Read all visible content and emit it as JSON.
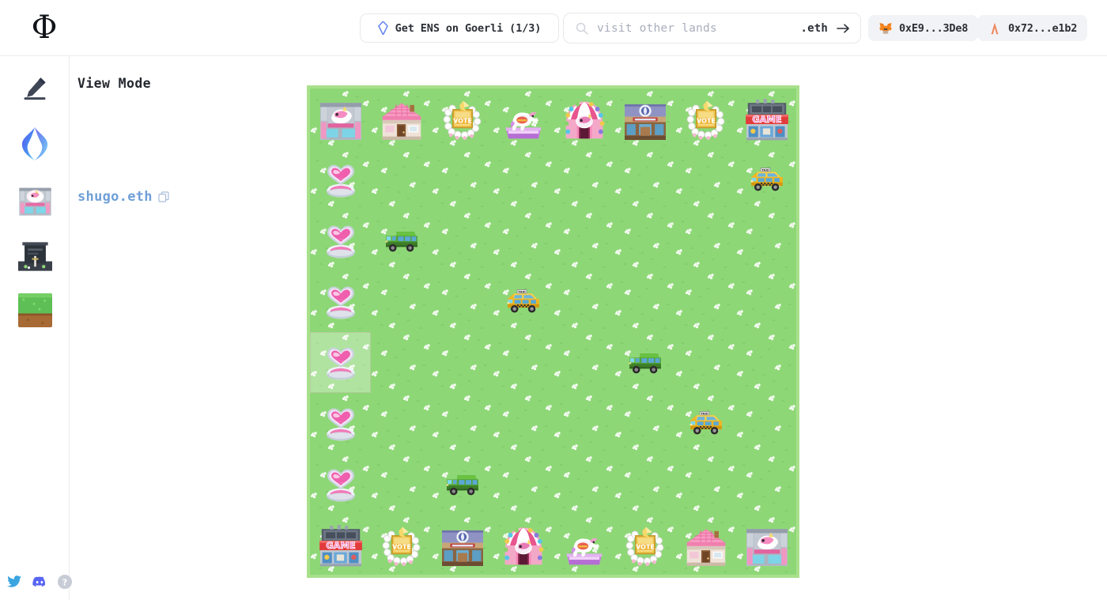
{
  "header": {
    "logo_glyph": "Φ",
    "ens_button": {
      "label": "Get ENS on Goerli (1/3)",
      "icon": "ens-diamond-icon"
    },
    "search": {
      "placeholder": "visit other lands",
      "value": "",
      "suffix": ".eth",
      "icon": "search-icon",
      "submit_icon": "arrow-right-icon"
    },
    "wallets": [
      {
        "label": "0xE9...3De8",
        "icon": "metamask-fox-icon"
      },
      {
        "label": "0x72...e1b2",
        "icon": "wallet-connect-icon"
      }
    ]
  },
  "sidebar": {
    "tools": [
      {
        "name": "edit-pen",
        "icon": "pen-icon"
      },
      {
        "name": "ens",
        "icon": "ens-logo-icon"
      },
      {
        "name": "shop",
        "icon": "unicorn-shop-sprite"
      },
      {
        "name": "building",
        "icon": "dark-building-sprite"
      },
      {
        "name": "ground",
        "icon": "grass-tile-sprite"
      }
    ],
    "socials": [
      {
        "name": "twitter",
        "icon": "twitter-icon"
      },
      {
        "name": "discord",
        "icon": "discord-icon"
      },
      {
        "name": "help",
        "icon": "help-circle-icon"
      }
    ]
  },
  "panel": {
    "mode_title": "View Mode",
    "ens_name": "shugo.eth",
    "copy_icon": "copy-icon"
  },
  "map": {
    "columns": 8,
    "rows": 8,
    "cell_size": 77,
    "grass_color": "#8ed777",
    "border_color": "#a8e08b",
    "hover_cell": {
      "col": 0,
      "row": 4
    },
    "objects": [
      {
        "col": 0,
        "row": 0,
        "type": "unicorn-shop",
        "label": "Unicorn Shop"
      },
      {
        "col": 1,
        "row": 0,
        "type": "pink-house",
        "label": "Pink House"
      },
      {
        "col": 2,
        "row": 0,
        "type": "vote-gate",
        "label": "Vote Gate"
      },
      {
        "col": 3,
        "row": 0,
        "type": "carousel-horse",
        "label": "Carousel Horse"
      },
      {
        "col": 4,
        "row": 0,
        "type": "circus-tent",
        "label": "Circus Tent"
      },
      {
        "col": 5,
        "row": 0,
        "type": "bank",
        "label": "Bank"
      },
      {
        "col": 6,
        "row": 0,
        "type": "vote-gate",
        "label": "Vote Gate"
      },
      {
        "col": 7,
        "row": 0,
        "type": "arcade",
        "label": "Game Arcade"
      },
      {
        "col": 0,
        "row": 1,
        "type": "heart-fountain",
        "label": "Heart Fountain"
      },
      {
        "col": 7,
        "row": 1,
        "type": "taxi",
        "label": "Taxi"
      },
      {
        "col": 0,
        "row": 2,
        "type": "heart-fountain",
        "label": "Heart Fountain"
      },
      {
        "col": 1,
        "row": 2,
        "type": "green-van",
        "label": "Green Van"
      },
      {
        "col": 0,
        "row": 3,
        "type": "heart-fountain",
        "label": "Heart Fountain"
      },
      {
        "col": 3,
        "row": 3,
        "type": "taxi",
        "label": "Taxi"
      },
      {
        "col": 0,
        "row": 4,
        "type": "heart-fountain",
        "label": "Heart Fountain"
      },
      {
        "col": 5,
        "row": 4,
        "type": "green-van",
        "label": "Green Van"
      },
      {
        "col": 0,
        "row": 5,
        "type": "heart-fountain",
        "label": "Heart Fountain"
      },
      {
        "col": 6,
        "row": 5,
        "type": "taxi",
        "label": "Taxi"
      },
      {
        "col": 0,
        "row": 6,
        "type": "heart-fountain",
        "label": "Heart Fountain"
      },
      {
        "col": 2,
        "row": 6,
        "type": "green-van",
        "label": "Green Van"
      },
      {
        "col": 0,
        "row": 7,
        "type": "arcade",
        "label": "Game Arcade"
      },
      {
        "col": 1,
        "row": 7,
        "type": "vote-gate",
        "label": "Vote Gate"
      },
      {
        "col": 2,
        "row": 7,
        "type": "bank",
        "label": "Bank"
      },
      {
        "col": 3,
        "row": 7,
        "type": "circus-tent",
        "label": "Circus Tent"
      },
      {
        "col": 4,
        "row": 7,
        "type": "carousel-horse",
        "label": "Carousel Horse"
      },
      {
        "col": 5,
        "row": 7,
        "type": "vote-gate",
        "label": "Vote Gate"
      },
      {
        "col": 6,
        "row": 7,
        "type": "pink-house",
        "label": "Pink House"
      },
      {
        "col": 7,
        "row": 7,
        "type": "unicorn-shop",
        "label": "Unicorn Shop"
      }
    ]
  }
}
